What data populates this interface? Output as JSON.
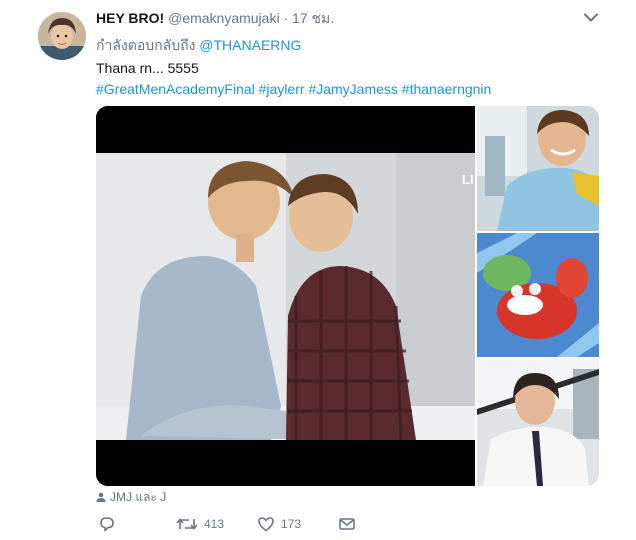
{
  "tweet": {
    "display_name": "HEY BRO!",
    "handle": "@emaknyamujaki",
    "separator": "·",
    "time": "17 ชม.",
    "reply_prefix": "กำลังตอบกลับถึง",
    "reply_mention": "@THANAERNG",
    "text": "Thana rn... 5555",
    "hashtags": [
      "#GreatMenAcademyFinal",
      "#jaylerr",
      "#JamyJamess",
      "#thanaerngnin"
    ],
    "tagged_people": "JMJ และ J",
    "video_watermark": "LI"
  },
  "actions": {
    "reply": {
      "icon": "reply-icon",
      "count": ""
    },
    "retweet": {
      "icon": "retweet-icon",
      "count": "413"
    },
    "like": {
      "icon": "heart-icon",
      "count": "173"
    },
    "message": {
      "icon": "envelope-icon",
      "count": ""
    }
  },
  "colors": {
    "link": "#1b95e0",
    "secondary_text": "#657786",
    "primary_text": "#14171a"
  }
}
